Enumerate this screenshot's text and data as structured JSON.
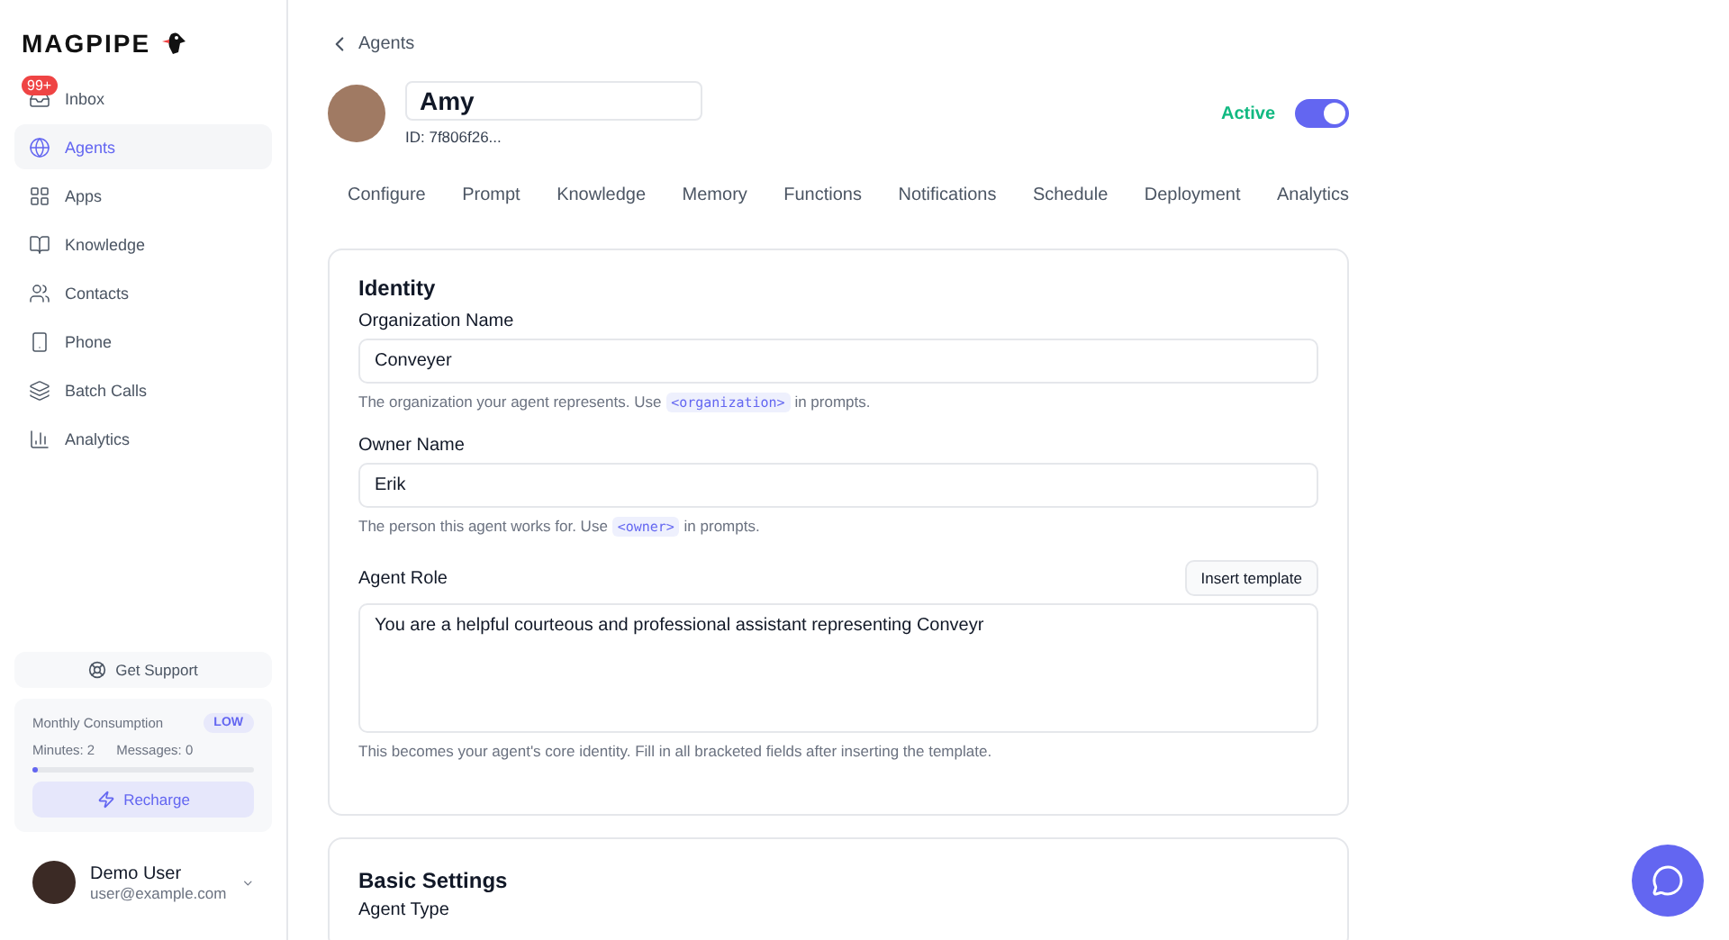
{
  "brand": {
    "name": "MAGPIPE"
  },
  "sidebar": {
    "items": [
      {
        "label": "Inbox",
        "selected": false,
        "badge": "99+"
      },
      {
        "label": "Agents",
        "selected": true
      },
      {
        "label": "Apps",
        "selected": false
      },
      {
        "label": "Knowledge",
        "selected": false
      },
      {
        "label": "Contacts",
        "selected": false
      },
      {
        "label": "Phone",
        "selected": false
      },
      {
        "label": "Batch Calls",
        "selected": false
      },
      {
        "label": "Analytics",
        "selected": false
      }
    ],
    "support": "Get Support",
    "consumption": {
      "title": "Monthly Consumption",
      "badge": "LOW",
      "minutes": "Minutes: 2",
      "messages": "Messages: 0",
      "level": 0.02,
      "button": "Recharge"
    },
    "user": {
      "name": "Demo User",
      "email": "user@example.com"
    }
  },
  "back": "Agents",
  "agent": {
    "name": "Amy",
    "id": "ID: 7f806f26...",
    "status": "Active",
    "on": true
  },
  "tabs": [
    {
      "label": "Configure"
    },
    {
      "label": "Prompt"
    },
    {
      "label": "Knowledge"
    },
    {
      "label": "Memory"
    },
    {
      "label": "Functions"
    },
    {
      "label": "Notifications"
    },
    {
      "label": "Schedule"
    },
    {
      "label": "Deployment"
    },
    {
      "label": "Analytics"
    }
  ],
  "identity": {
    "title": "Identity",
    "fields": [
      {
        "kind": "input",
        "label": "Organization Name",
        "value": "Conveyer",
        "hint": {
          "before": "The organization your agent represents. Use",
          "code": "<organization>",
          "after": "in prompts."
        }
      },
      {
        "kind": "input",
        "label": "Owner Name",
        "value": "Erik",
        "hint": {
          "before": "The person this agent works for. Use",
          "code": "<owner>",
          "after": "in prompts."
        }
      },
      {
        "kind": "textarea",
        "label": "Agent Role",
        "action": "Insert template",
        "value": "You are a helpful courteous and professional assistant representing Conveyr",
        "hint": {
          "before": "This becomes your agent's core identity. Fill in all bracketed fields after inserting the template."
        }
      }
    ]
  },
  "basic": {
    "title": "Basic Settings",
    "first_label": "Agent Type"
  }
}
